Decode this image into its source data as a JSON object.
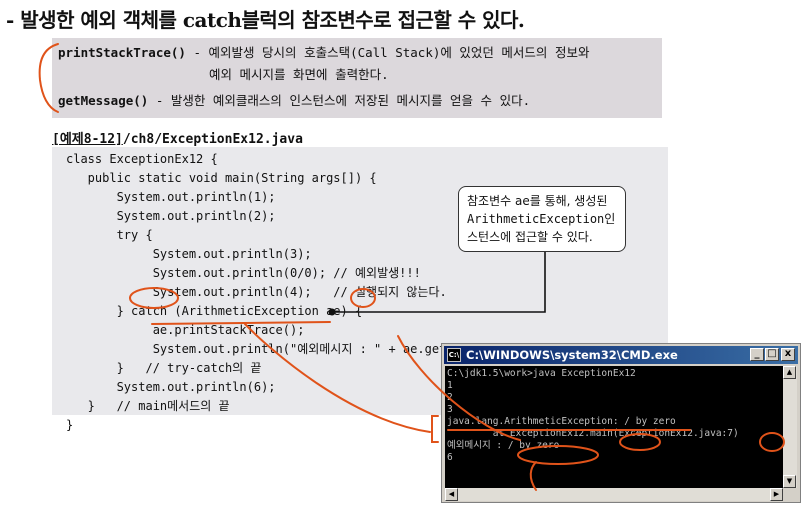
{
  "heading": "- 발생한 예외 객체를 catch블럭의 참조변수로 접근할 수 있다.",
  "methods": [
    {
      "name": "printStackTrace()",
      "desc1": " - 예외발생 당시의 호출스택(Call Stack)에 있었던 메서드의 정보와",
      "desc2": "예외 메시지를 화면에 출력한다."
    },
    {
      "name": "getMessage()",
      "desc1": " - 발생한 예외클래스의 인스턴스에 저장된 메시지를 얻을 수 있다."
    }
  ],
  "example": {
    "label": "[예제8-12]",
    "path": "/ch8/ExceptionEx12.java"
  },
  "code_lines": [
    "class ExceptionEx12 {",
    "   public static void main(String args[]) {",
    "       System.out.println(1);",
    "       System.out.println(2);",
    "       try {",
    "            System.out.println(3);",
    "            System.out.println(0/0); // 예외발생!!!",
    "            System.out.println(4);   // 실행되지 않는다.",
    "       } catch (ArithmeticException ae) {",
    "            ae.printStackTrace();",
    "            System.out.println(\"예외메시지 : \" + ae.getMessage());",
    "       }   // try-catch의 끝",
    "       System.out.println(6);",
    "   }   // main메서드의 끝",
    "}"
  ],
  "callout": {
    "line1": "참조변수 ae를 통해, 생성된",
    "line2": "ArithmeticException인",
    "line3": "스턴스에 접근할 수 있다."
  },
  "console": {
    "title": "C:\\WINDOWS\\system32\\CMD.exe",
    "icon": "cmd-icon",
    "buttons": {
      "minimize": "_",
      "maximize": "□",
      "close": "x"
    },
    "lines": [
      "C:\\jdk1.5\\work>java ExceptionEx12",
      "1",
      "2",
      "3",
      "java.lang.ArithmeticException: / by zero",
      "        at ExceptionEx12.main(ExceptionEx12.java:7)",
      "예외메시지 : / by zero",
      "6"
    ]
  },
  "colors": {
    "annotation": "#e0531a",
    "code_bg": "#e9e9ec",
    "desc_bg": "#dcd8dc",
    "title_bar": "#0a246a"
  }
}
